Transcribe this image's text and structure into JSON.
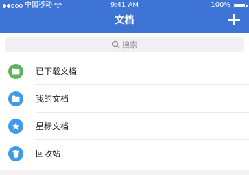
{
  "status_bar": {
    "carrier": "中国移动",
    "time": "9:41 AM",
    "battery_percent": "100%"
  },
  "header": {
    "title": "文档",
    "add_icon": "plus-icon"
  },
  "search": {
    "placeholder": "搜索",
    "icon": "search-icon"
  },
  "list": {
    "items": [
      {
        "label": "已下载文档",
        "icon": "folder-icon",
        "color": "#5fb35a"
      },
      {
        "label": "我的文档",
        "icon": "folder-icon",
        "color": "#3f9ae8"
      },
      {
        "label": "星标文档",
        "icon": "star-icon",
        "color": "#3f9ae8"
      },
      {
        "label": "回收站",
        "icon": "trash-icon",
        "color": "#3f9ae8"
      }
    ]
  },
  "colors": {
    "header": "#3d74d6",
    "downloaded": "#5fb35a",
    "blue": "#3f9ae8"
  }
}
